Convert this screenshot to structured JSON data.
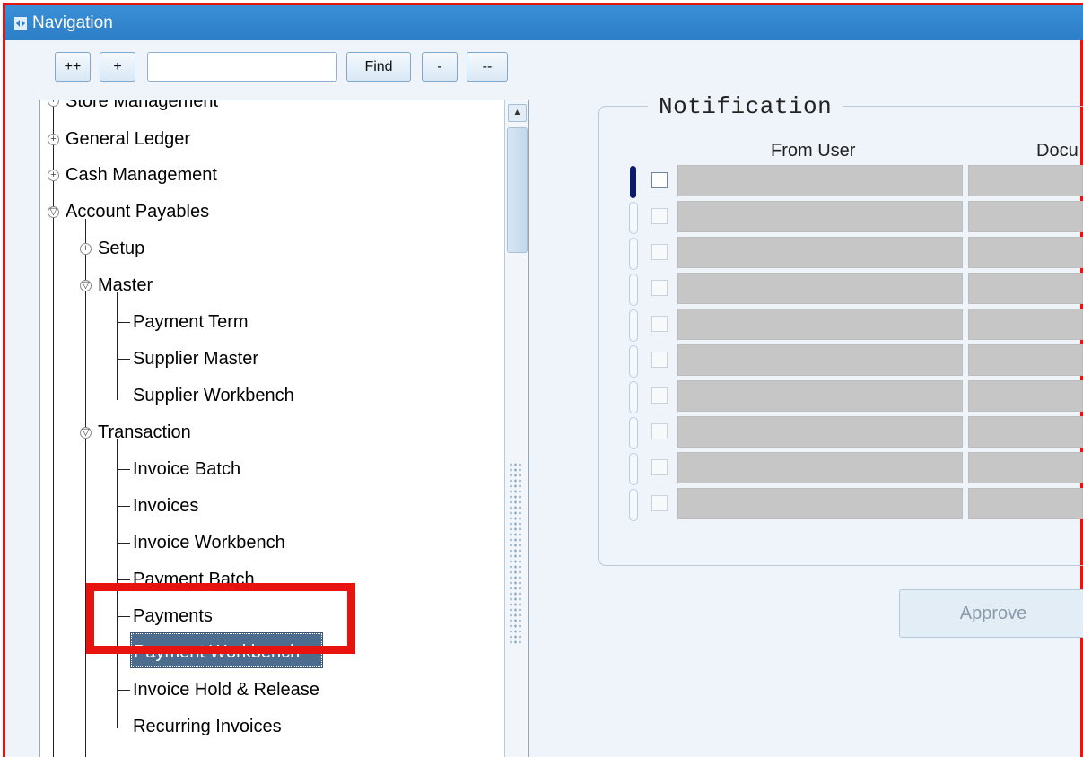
{
  "window": {
    "title": "Navigation"
  },
  "toolbar": {
    "expand_all_label": "++",
    "expand_label": "+",
    "search_value": "",
    "find_label": "Find",
    "collapse_label": "-",
    "collapse_all_label": "--"
  },
  "tree": {
    "items": [
      {
        "label": "Store Management"
      },
      {
        "label": "General Ledger"
      },
      {
        "label": "Cash Management"
      },
      {
        "label": "Account Payables"
      },
      {
        "label": "Setup"
      },
      {
        "label": "Master"
      },
      {
        "label": "Payment Term"
      },
      {
        "label": "Supplier Master"
      },
      {
        "label": "Supplier Workbench"
      },
      {
        "label": "Transaction"
      },
      {
        "label": "Invoice Batch"
      },
      {
        "label": "Invoices"
      },
      {
        "label": "Invoice Workbench"
      },
      {
        "label": "Payment Batch"
      },
      {
        "label": "Payments"
      },
      {
        "label": "Payment Workbench"
      },
      {
        "label": "Invoice Hold & Release"
      },
      {
        "label": "Recurring Invoices"
      }
    ]
  },
  "notification": {
    "title": "Notification",
    "columns": [
      "From User",
      "Docu"
    ],
    "row_count": 10
  },
  "actions": {
    "approve_label": "Approve"
  },
  "colors": {
    "titlebar": "#2c7ec7",
    "highlight": "#e8120f",
    "selection": "#4d6d8e"
  }
}
